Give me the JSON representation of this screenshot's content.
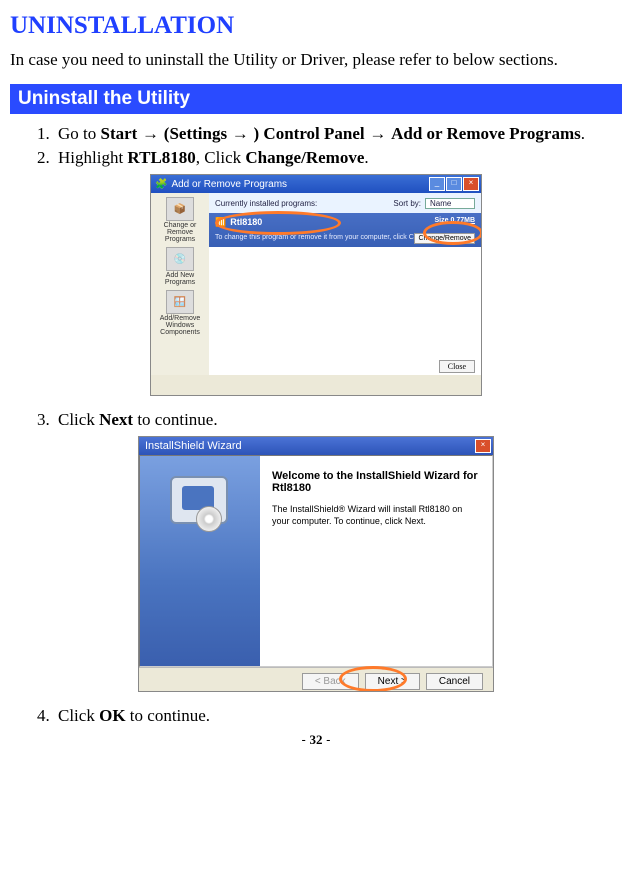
{
  "title": "UNINSTALLATION",
  "intro": "In case you need to uninstall the Utility or Driver, please refer to below sections.",
  "section_bar": "Uninstall the Utility",
  "steps": {
    "s1_pre": "Go to ",
    "s1_bold1": "Start",
    "s1_arrow": " → ",
    "s1_bold2": "(Settings",
    "s1_bold3": ") Control Panel",
    "s1_bold4": "Add or Remove Programs",
    "s2_pre": "Highlight ",
    "s2_bold1": "RTL8180",
    "s2_mid": ", Click ",
    "s2_bold2": "Change/Remove",
    "s3_pre": "Click ",
    "s3_bold": "Next",
    "s3_post": " to continue.",
    "s4_pre": "Click ",
    "s4_bold": "OK",
    "s4_post": " to continue."
  },
  "shot1": {
    "title": "Add or Remove Programs",
    "currently": "Currently installed programs:",
    "sortby": "Sort by:",
    "sort_value": "Name",
    "program": "Rtl8180",
    "size_label": "Size",
    "size_value": "0.77MB",
    "desc": "To change this program or remove it from your computer, click Change/Remove.",
    "changeremove": "Change/Remove",
    "close": "Close",
    "left": {
      "i1": "Change or Remove Programs",
      "i2": "Add New Programs",
      "i3": "Add/Remove Windows Components"
    }
  },
  "shot2": {
    "title": "InstallShield Wizard",
    "welcome": "Welcome to the InstallShield Wizard for Rtl8180",
    "text": "The InstallShield® Wizard will install Rtl8180 on your computer. To continue, click Next.",
    "back": "< Back",
    "next": "Next >",
    "cancel": "Cancel"
  },
  "page_number": "32"
}
